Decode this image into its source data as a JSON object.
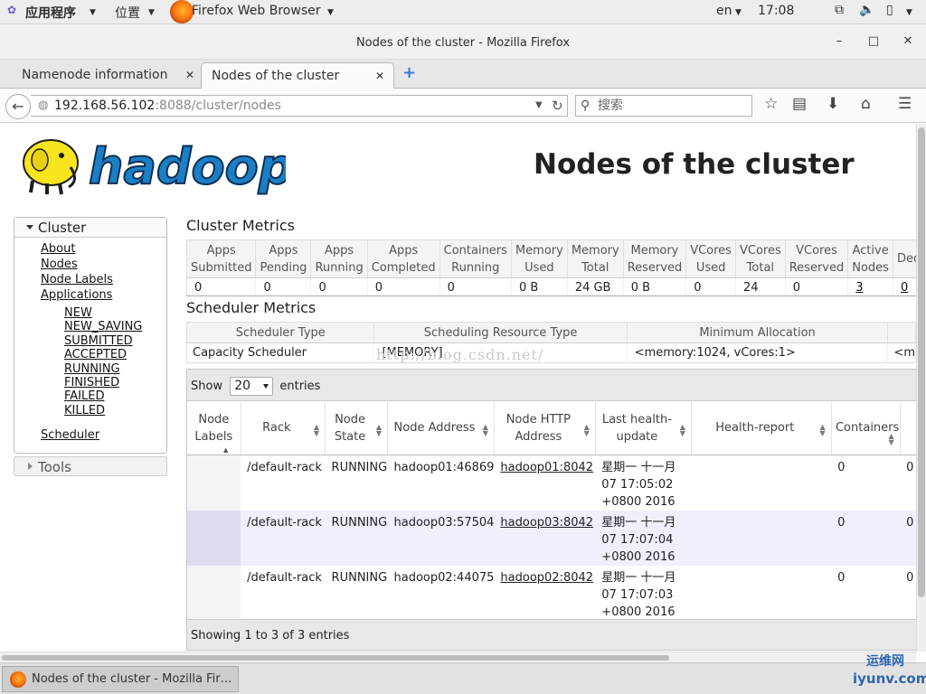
{
  "gnome": {
    "apps_menu": "应用程序",
    "places_menu": "位置",
    "browser_menu": "Firefox Web Browser",
    "lang": "en",
    "clock": "17:08"
  },
  "window": {
    "title": "Nodes of the cluster - Mozilla Firefox",
    "minimize": "–",
    "maximize": "□",
    "close": "✕"
  },
  "tabs": [
    {
      "label": "Namenode information",
      "close": "✕"
    },
    {
      "label": "Nodes of the cluster",
      "close": "✕"
    }
  ],
  "new_tab": "+",
  "url": {
    "host": "192.168.56.102",
    "path": ":8088/cluster/nodes"
  },
  "search": {
    "placeholder": "搜索"
  },
  "page": {
    "logo_text": "hadoop",
    "title": "Nodes of the cluster"
  },
  "sidebar": {
    "cluster_label": "Cluster",
    "links": [
      "About",
      "Nodes",
      "Node Labels",
      "Applications"
    ],
    "app_states": [
      "NEW",
      "NEW_SAVING",
      "SUBMITTED",
      "ACCEPTED",
      "RUNNING",
      "FINISHED",
      "FAILED",
      "KILLED"
    ],
    "scheduler": "Scheduler",
    "tools_label": "Tools"
  },
  "cluster_metrics": {
    "heading": "Cluster Metrics",
    "headers": [
      [
        "Apps",
        "Submitted"
      ],
      [
        "Apps",
        "Pending"
      ],
      [
        "Apps",
        "Running"
      ],
      [
        "Apps",
        "Completed"
      ],
      [
        "Containers",
        "Running"
      ],
      [
        "Memory",
        "Used"
      ],
      [
        "Memory",
        "Total"
      ],
      [
        "Memory",
        "Reserved"
      ],
      [
        "VCores",
        "Used"
      ],
      [
        "VCores",
        "Total"
      ],
      [
        "VCores",
        "Reserved"
      ],
      [
        "Active",
        "Nodes"
      ],
      [
        "Deco",
        ""
      ]
    ],
    "values": [
      "0",
      "0",
      "0",
      "0",
      "0",
      "0 B",
      "24 GB",
      "0 B",
      "0",
      "24",
      "0",
      "3",
      "0"
    ]
  },
  "scheduler_metrics": {
    "heading": "Scheduler Metrics",
    "headers": [
      "Scheduler Type",
      "Scheduling Resource Type",
      "Minimum Allocation",
      ""
    ],
    "values": [
      "Capacity Scheduler",
      "[MEMORY]",
      "<memory:1024, vCores:1>",
      "<m"
    ]
  },
  "nodes_table": {
    "show_label": "Show",
    "show_value": "20",
    "entries_label": "entries",
    "headers": [
      [
        "Node",
        "Labels"
      ],
      [
        "Rack",
        ""
      ],
      [
        "Node",
        "State"
      ],
      [
        "Node Address",
        ""
      ],
      [
        "Node HTTP",
        "Address"
      ],
      [
        "Last health-",
        "update"
      ],
      [
        "Health-report",
        ""
      ],
      [
        "Containers",
        ""
      ],
      [
        "",
        ""
      ]
    ],
    "rows": [
      {
        "labels": "",
        "rack": "/default-rack",
        "state": "RUNNING",
        "address": "hadoop01:46869",
        "http": "hadoop01:8042",
        "update": [
          "星期一 十一月",
          "07 17:05:02",
          "+0800 2016"
        ],
        "health": "",
        "containers": "0",
        "extra": "0"
      },
      {
        "labels": "",
        "rack": "/default-rack",
        "state": "RUNNING",
        "address": "hadoop03:57504",
        "http": "hadoop03:8042",
        "update": [
          "星期一 十一月",
          "07 17:07:04",
          "+0800 2016"
        ],
        "health": "",
        "containers": "0",
        "extra": "0"
      },
      {
        "labels": "",
        "rack": "/default-rack",
        "state": "RUNNING",
        "address": "hadoop02:44075",
        "http": "hadoop02:8042",
        "update": [
          "星期一 十一月",
          "07 17:07:03",
          "+0800 2016"
        ],
        "health": "",
        "containers": "0",
        "extra": "0"
      }
    ],
    "footer": "Showing 1 to 3 of 3 entries"
  },
  "watermark": "http://blog.csdn.net/",
  "taskbar": {
    "item": "Nodes of the cluster - Mozilla Fir…"
  },
  "corner_watermark": {
    "top": "运维网",
    "bottom": "iyunv.com"
  }
}
